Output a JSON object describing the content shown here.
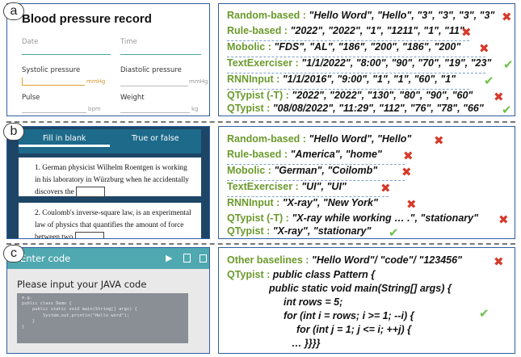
{
  "panels": {
    "a": {
      "badge": "a",
      "form": {
        "title": "Blood pressure record",
        "date_label": "Date",
        "time_label": "Time",
        "systolic_label": "Systolic pressure",
        "diastolic_label": "Diastolic pressure",
        "unit_mmhg": "mmHg",
        "pulse_label": "Pulse",
        "pulse_unit": "bpm",
        "weight_label": "Weight",
        "weight_unit": "kg"
      },
      "results": [
        {
          "label": "Random-based : ",
          "values": "\"Hello Word\", \"Hello\", \"3\", \"3\", \"3\", \"3\"",
          "ok": false
        },
        {
          "label": "Rule-based : ",
          "values": "\"2022\", \"2022\", \"1\", \"1211\", \"1\", \"11\"",
          "ok": false
        },
        {
          "label": "Mobolic : ",
          "values": "\"FDS\", \"AL\", \"186\", \"200\", \"186\", \"200\"",
          "ok": false
        },
        {
          "label": "TextExerciser : ",
          "values": "\"1/1/2022\", \"8:00\", \"90\", \"70\", \"19\", \"23\"",
          "ok": true
        },
        {
          "label": "RNNInput : ",
          "values": "\"1/1/2016\", \"9:00\", \"1\", \"1\", \"60\", \"1\"",
          "ok": true
        },
        {
          "label": "QTypist (-T) : ",
          "values": "\"2022\", \"2022\", \"130\", \"80\", \"90\", \"60\"",
          "ok": false
        },
        {
          "label": "QTypist : ",
          "values": "\"08/08/2022\", \"11:29\", \"112\", \"76\", \"78\", \"66\"",
          "ok": true
        }
      ]
    },
    "b": {
      "badge": "b",
      "tabs": [
        "Fill in blank",
        "True or false"
      ],
      "q1": "1. German physicist Wilhelm Roentgen is working in his laboratory in Würzburg when he accidentally discovers the",
      "q2": "2. Coulomb's inverse-square law, is an experimental law of physics that quantifies the amount of force between two",
      "results": [
        {
          "label": "Random-based : ",
          "values": "\"Hello Word\", \"Hello\"",
          "ok": false
        },
        {
          "label": "Rule-based : ",
          "values": "\"America\", \"home\"",
          "ok": false
        },
        {
          "label": "Mobolic : ",
          "values": "\"German\", \"Coilomb\"",
          "ok": false
        },
        {
          "label": "TextExerciser : ",
          "values": "\"UI\", \"UI\"",
          "ok": false
        },
        {
          "label": "RNNInput : ",
          "values": "\"X-ray\", \"New York\"",
          "ok": false
        },
        {
          "label": "QTypist (-T) : ",
          "values": "\"X-ray while working … .\", \"stationary\"",
          "ok": false
        },
        {
          "label": "QTypist : ",
          "values": "\"X-ray\", \"stationary\"",
          "ok": true
        }
      ]
    },
    "c": {
      "badge": "c",
      "bar_title": "Enter code",
      "prompt": "Please input your JAVA code",
      "code_hint": "e.g.\npublic class Demo {\n    public static void main(String[] args) {\n        System.out.println(\"Hello word\");\n    }\n}",
      "other_label": "Other baselines : ",
      "other_values": "\"Hello Word\"/ \"code\"/ \"123456\"",
      "other_ok": false,
      "qtypist_label": "QTypist : ",
      "code_lines": [
        "public class Pattern {",
        "public static void main(String[] args) {",
        "int rows = 5;",
        "for (int i = rows; i >= 1; --i) {",
        "for (int j = 1; j <= i; ++j) {",
        "… }}}}"
      ],
      "qtypist_ok": true
    }
  },
  "marks": {
    "cross": "✖",
    "check": "✔"
  },
  "colors": {
    "label_green": "#6b9a2c",
    "cross_red": "#d63a2a",
    "check_green": "#6fc04a",
    "frame_blue": "#2f5ea0"
  }
}
